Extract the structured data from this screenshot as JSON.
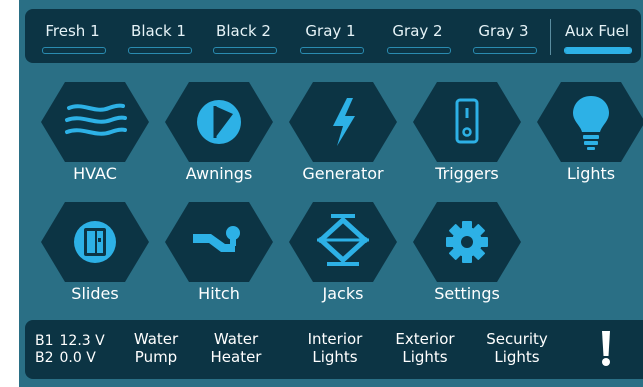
{
  "tanks": [
    {
      "label": "Fresh 1",
      "level": 0,
      "active": false
    },
    {
      "label": "Black 1",
      "level": 0,
      "active": false
    },
    {
      "label": "Black 2",
      "level": 0,
      "active": false
    },
    {
      "label": "Gray 1",
      "level": 0,
      "active": false
    },
    {
      "label": "Gray 2",
      "level": 0,
      "active": false
    },
    {
      "label": "Gray 3",
      "level": 0,
      "active": false
    },
    {
      "label": "Aux Fuel",
      "level": 1.0,
      "active": true
    }
  ],
  "tiles": [
    {
      "label": "HVAC",
      "icon": "hvac-icon"
    },
    {
      "label": "Awnings",
      "icon": "awning-icon"
    },
    {
      "label": "Generator",
      "icon": "lightning-bolt-icon"
    },
    {
      "label": "Triggers",
      "icon": "switch-icon"
    },
    {
      "label": "Lights",
      "icon": "light-bulb-icon"
    },
    {
      "label": "Slides",
      "icon": "slide-out-icon"
    },
    {
      "label": "Hitch",
      "icon": "trailer-hitch-icon"
    },
    {
      "label": "Jacks",
      "icon": "scissor-jack-icon"
    },
    {
      "label": "Settings",
      "icon": "gear-icon"
    }
  ],
  "status": {
    "battery1_label": "B1",
    "battery1_value": "12.3 V",
    "battery2_label": "B2",
    "battery2_value": "0.0 V",
    "buttons": [
      {
        "line1": "Water",
        "line2": "Pump"
      },
      {
        "line1": "Water",
        "line2": "Heater"
      },
      {
        "line1": "Interior",
        "line2": "Lights"
      },
      {
        "line1": "Exterior",
        "line2": "Lights"
      },
      {
        "line1": "Security",
        "line2": "Lights"
      }
    ],
    "alert_icon": "exclamation-icon"
  },
  "colors": {
    "background": "#2a6f85",
    "panel": "#0c3444",
    "hex": "#0c3444",
    "accent": "#2db1e6"
  }
}
